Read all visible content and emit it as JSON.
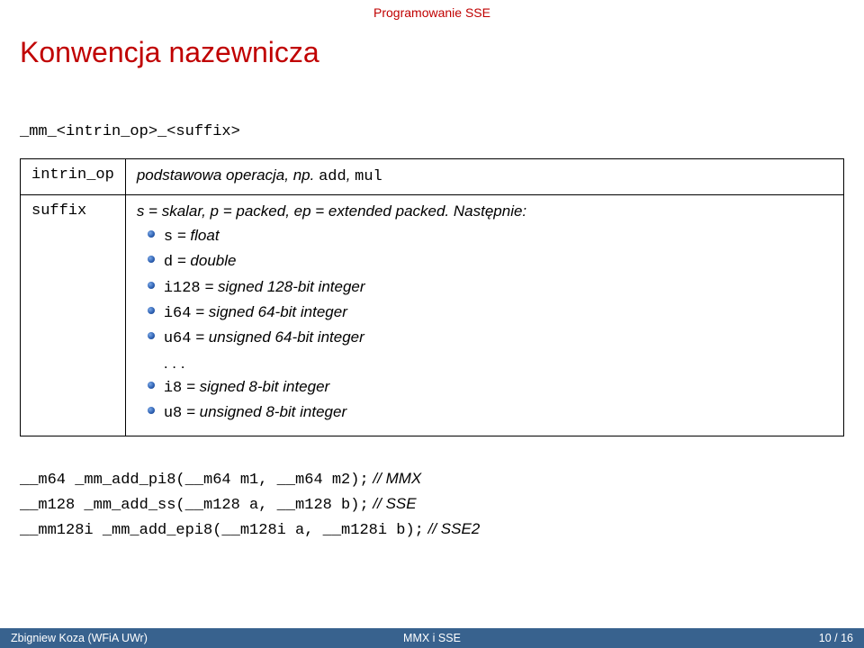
{
  "header": {
    "section": "Programowanie SSE",
    "title": "Konwencja nazewnicza"
  },
  "pattern": "_mm_<intrin_op>_<suffix>",
  "table": {
    "rows": [
      {
        "key": "intrin_op",
        "desc_prefix": "podstawowa operacja, np. ",
        "desc_code": "add",
        "desc_mid": ", ",
        "desc_code2": "mul"
      },
      {
        "key": "suffix",
        "desc_line": "s = skalar, p = packed, ep = extended packed. Następnie:",
        "bullets": [
          {
            "code": "s",
            "text": " = float"
          },
          {
            "code": "d",
            "text": " = double"
          },
          {
            "code": "i128",
            "text": " = signed 128-bit integer"
          },
          {
            "code": "i64",
            "text": " = signed 64-bit integer"
          },
          {
            "code": "u64",
            "text": " = unsigned 64-bit integer"
          }
        ],
        "ellipsis": ". . .",
        "bullets2": [
          {
            "code": "i8",
            "text": " = signed 8-bit integer"
          },
          {
            "code": "u8",
            "text": " = unsigned 8-bit integer"
          }
        ]
      }
    ]
  },
  "examples": [
    {
      "code": "__m64 _mm_add_pi8(__m64 m1, __m64 m2);",
      "comment": " // MMX"
    },
    {
      "code": "__m128 _mm_add_ss(__m128 a, __m128 b);",
      "comment": " // SSE"
    },
    {
      "code": "__mm128i _mm_add_epi8(__m128i a, __m128i b);",
      "comment": " // SSE2"
    }
  ],
  "footer": {
    "left": "Zbigniew Koza (WFiA UWr)",
    "center": "MMX i SSE",
    "right": "10 / 16"
  }
}
